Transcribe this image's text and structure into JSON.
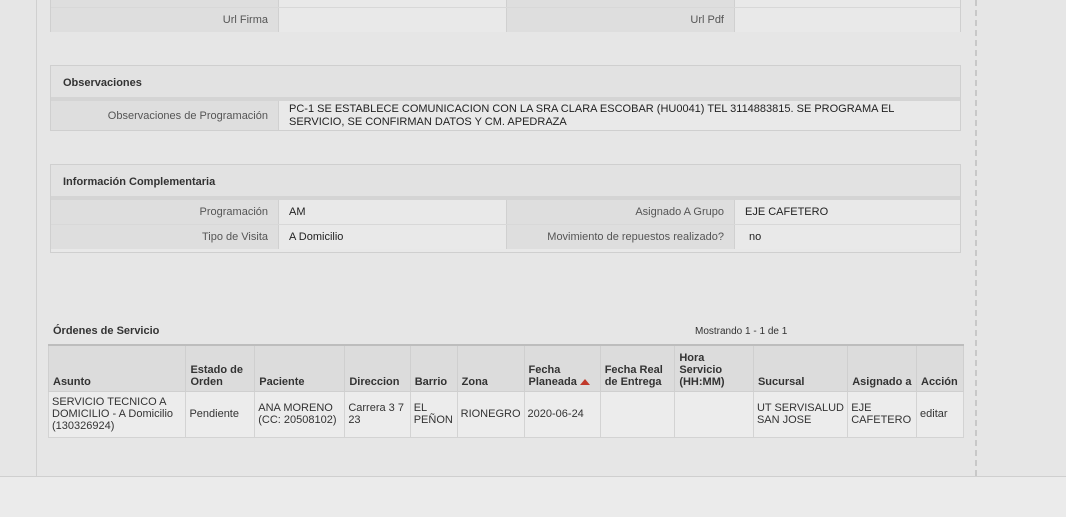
{
  "top_row": {
    "label1": "Url Firma",
    "value1": "",
    "label2": "Url Pdf",
    "value2": ""
  },
  "observaciones": {
    "title": "Observaciones",
    "label": "Observaciones de Programación",
    "value": "PC-1 SE ESTABLECE COMUNICACION CON LA SRA CLARA ESCOBAR (HU0041) TEL 3114883815. SE PROGRAMA EL SERVICIO, SE CONFIRMAN DATOS Y CM. APEDRAZA"
  },
  "info": {
    "title": "Información Complementaria",
    "programacion_label": "Programación",
    "programacion_value": "AM",
    "grupo_label": "Asignado A Grupo",
    "grupo_value": "EJE CAFETERO",
    "visita_label": "Tipo de Visita",
    "visita_value": "A Domicilio",
    "repuestos_label": "Movimiento de repuestos realizado?",
    "repuestos_value": "no"
  },
  "orders": {
    "title": "Órdenes de Servicio",
    "showing": "Mostrando 1 - 1 de 1",
    "headers": [
      "Asunto",
      "Estado de Orden",
      "Paciente",
      "Direccion",
      "Barrio",
      "Zona",
      "Fecha Planeada",
      "Fecha Real de Entrega",
      "Hora Servicio (HH:MM)",
      "Sucursal",
      "Asignado a",
      "Acción"
    ],
    "row": {
      "asunto": "SERVICIO TECNICO A DOMICILIO - A Domicilio (130326924)",
      "estado": "Pendiente",
      "paciente": "ANA MORENO (CC: 20508102)",
      "direccion": "Carrera 3 7 23",
      "barrio": "EL PEÑON",
      "zona": "RIONEGRO",
      "fecha_planeada": "2020-06-24",
      "fecha_real": "",
      "hora": "",
      "sucursal": "UT SERVISALUD SAN JOSE",
      "asignado": "EJE CAFETERO",
      "accion": "editar"
    }
  },
  "colors": {
    "sort_arrow": "#c0392b"
  }
}
